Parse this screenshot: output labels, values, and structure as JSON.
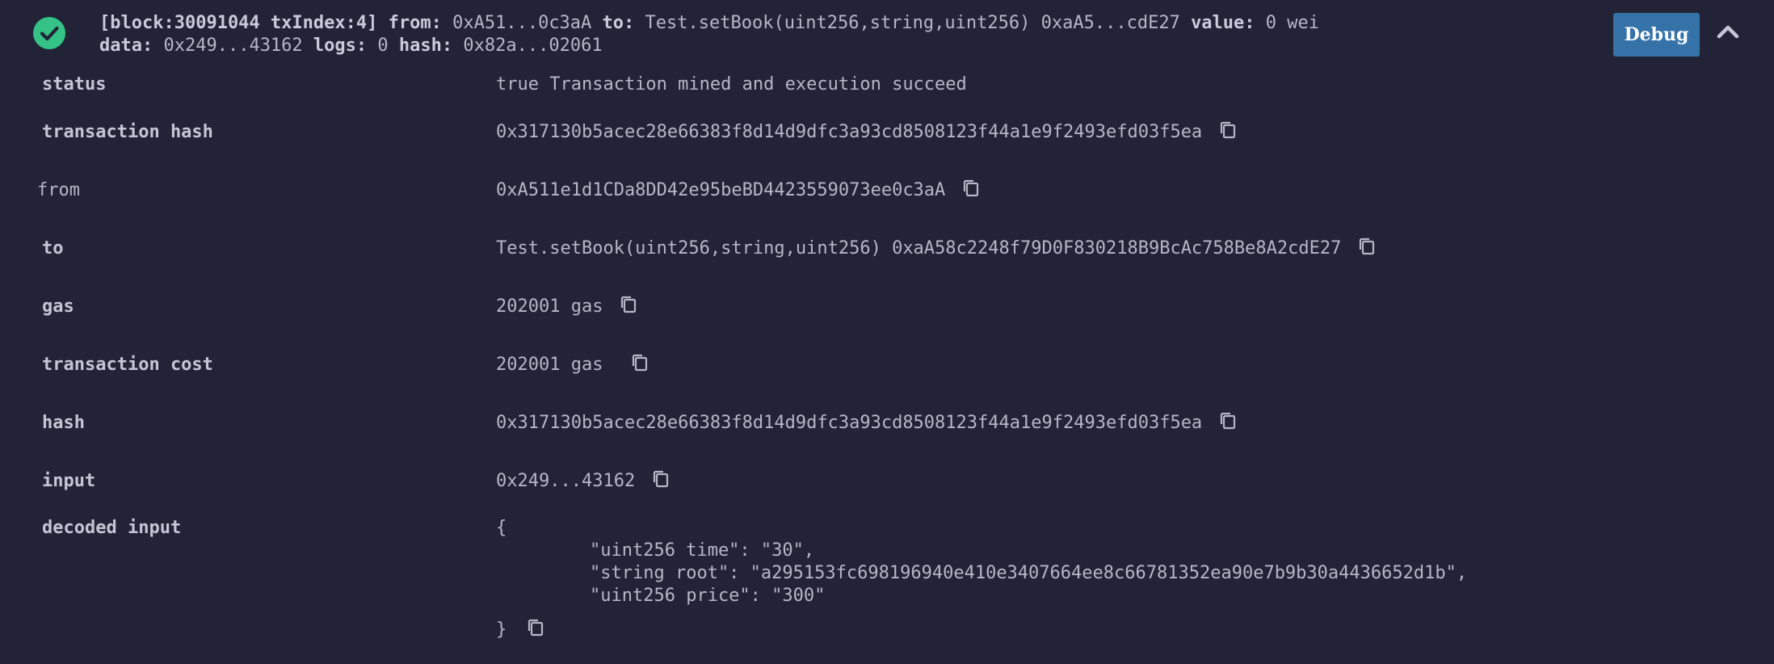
{
  "header": {
    "block_info": "[block:30091044 txIndex:4]",
    "from_label": "from:",
    "from_value": "0xA51...0c3aA",
    "to_label": "to:",
    "to_value": "Test.setBook(uint256,string,uint256) 0xaA5...cdE27",
    "value_label": "value:",
    "value_value": "0 wei",
    "data_label": "data:",
    "data_value": "0x249...43162",
    "logs_label": "logs:",
    "logs_value": "0",
    "hash_label": "hash:",
    "hash_value": "0x82a...02061",
    "debug_label": "Debug",
    "icons": {
      "status": "check-circle-icon",
      "collapse": "chevron-up-icon"
    },
    "status_color": "#34c286",
    "debug_color": "#3472a8"
  },
  "rows": {
    "status": {
      "label": "status",
      "value": "true Transaction mined and execution succeed"
    },
    "transaction_hash": {
      "label": "transaction hash",
      "value": "0x317130b5acec28e66383f8d14d9dfc3a93cd8508123f44a1e9f2493efd03f5ea"
    },
    "from": {
      "label": "from",
      "value": "0xA511e1d1CDa8DD42e95beBD4423559073ee0c3aA"
    },
    "to": {
      "label": "to",
      "value": "Test.setBook(uint256,string,uint256) 0xaA58c2248f79D0F830218B9BcAc758Be8A2cdE27"
    },
    "gas": {
      "label": "gas",
      "value": "202001 gas"
    },
    "transaction_cost": {
      "label": "transaction cost",
      "value": "202001 gas"
    },
    "hash": {
      "label": "hash",
      "value": "0x317130b5acec28e66383f8d14d9dfc3a93cd8508123f44a1e9f2493efd03f5ea"
    },
    "input": {
      "label": "input",
      "value": "0x249...43162"
    },
    "decoded_input": {
      "label": "decoded input",
      "open_brace": "{",
      "lines": [
        "\"uint256 time\": \"30\",",
        "\"string root\": \"a295153fc698196940e410e3407664ee8c66781352ea90e7b9b30a4436652d1b\",",
        "\"uint256 price\": \"300\""
      ],
      "close_brace": "}"
    }
  },
  "copy_icon": "copy-icon"
}
